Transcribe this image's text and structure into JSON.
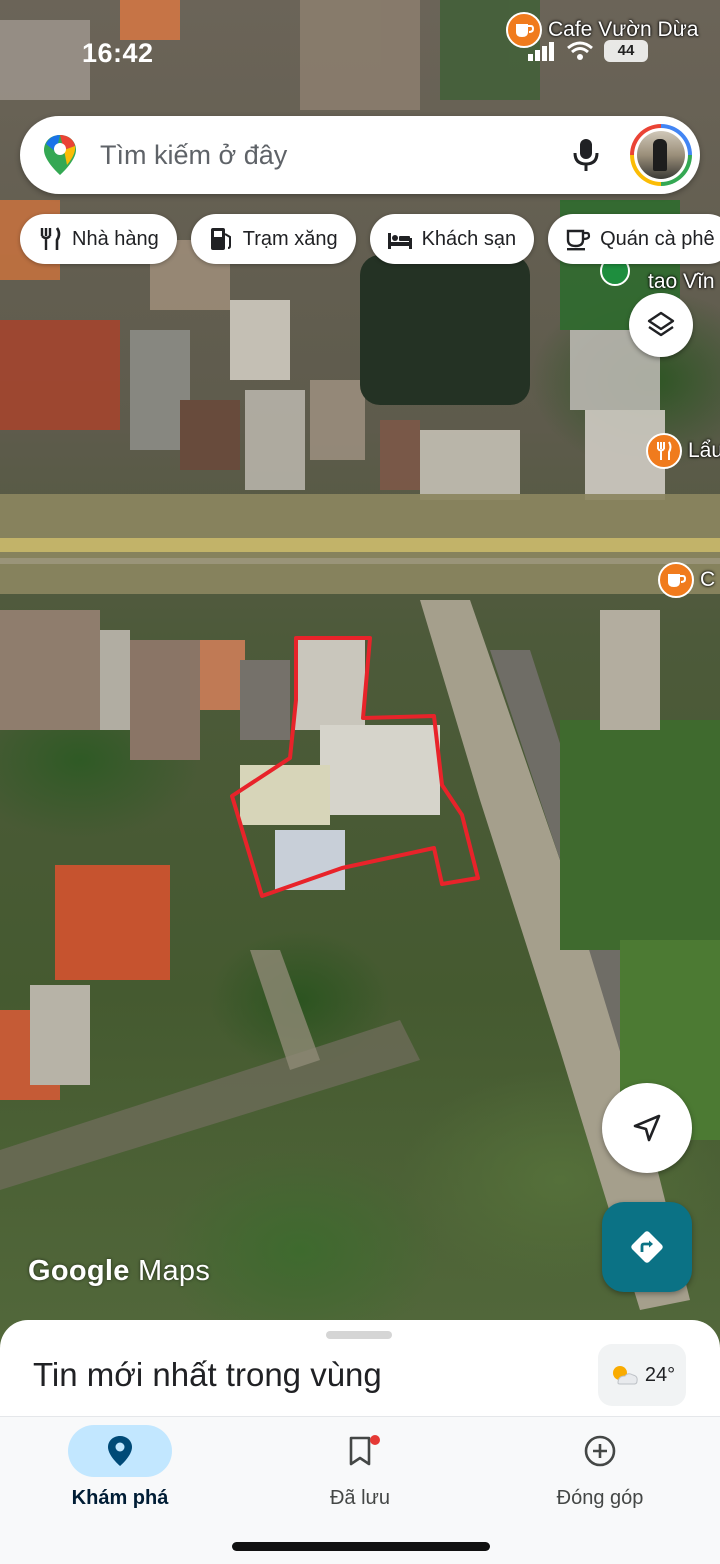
{
  "status_bar": {
    "time": "16:42",
    "battery": "44"
  },
  "places": [
    {
      "name": "Cafe Vườn Dừa",
      "icon": "coffee-icon"
    },
    {
      "name": "tao Vĩn",
      "icon": "green-pin-icon"
    },
    {
      "name": "Lẩu",
      "icon": "restaurant-icon"
    },
    {
      "name": "C",
      "icon": "coffee-icon"
    }
  ],
  "search": {
    "placeholder": "Tìm kiếm ở đây"
  },
  "chips": [
    {
      "label": "Nhà hàng",
      "icon": "fork-knife-icon"
    },
    {
      "label": "Trạm xăng",
      "icon": "gas-pump-icon"
    },
    {
      "label": "Khách sạn",
      "icon": "bed-icon"
    },
    {
      "label": "Quán cà phê",
      "icon": "coffee-cup-icon"
    }
  ],
  "brand": {
    "google": "Google",
    "maps": "Maps"
  },
  "sheet": {
    "title": "Tin mới nhất trong vùng",
    "weather": "24°"
  },
  "nav": [
    {
      "label": "Khám phá",
      "icon": "location-pin-icon",
      "active": true
    },
    {
      "label": "Đã lưu",
      "icon": "bookmark-icon",
      "active": false
    },
    {
      "label": "Đóng góp",
      "icon": "add-circle-icon",
      "active": false
    }
  ],
  "colors": {
    "accent": "#0b7285",
    "marked_boundary": "#e8232a",
    "poi_orange": "#f07b1d",
    "active_nav": "#c2e7ff"
  }
}
